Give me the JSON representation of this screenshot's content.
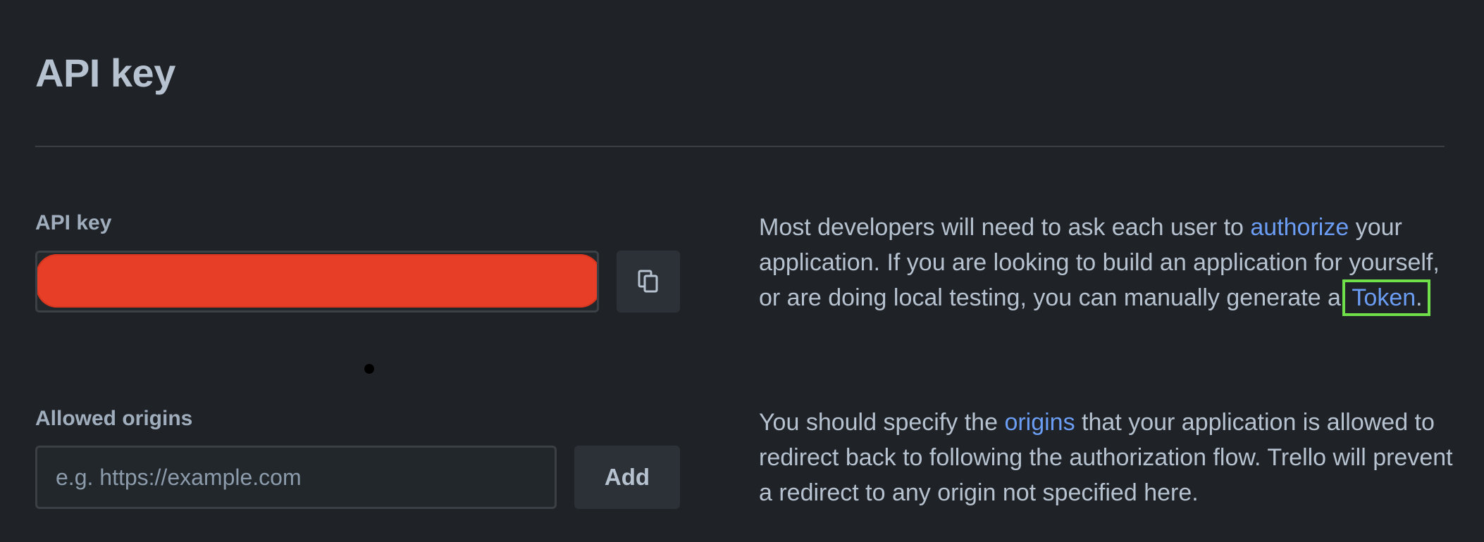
{
  "page": {
    "title": "API key"
  },
  "api_key": {
    "label": "API key",
    "value": "",
    "copy_icon": "copy-icon"
  },
  "help_authorize": {
    "text_before_authorize": "Most developers will need to ask each user to ",
    "authorize_link": "authorize",
    "text_after_authorize": " your application. If you are looking to build an application for yourself, or are doing local testing, you can manually generate a ",
    "token_link": "Token",
    "text_end": "."
  },
  "allowed_origins": {
    "label": "Allowed origins",
    "placeholder": "e.g. https://example.com",
    "value": "",
    "add_label": "Add"
  },
  "help_origins": {
    "text_before_origins": "You should specify the ",
    "origins_link": "origins",
    "text_after_origins": " that your application is allowed to redirect back to following the authorization flow. Trello will prevent a redirect to any origin not specified here."
  },
  "colors": {
    "background": "#1f2227",
    "text": "#b6c2cf",
    "link": "#6b9df5",
    "redaction": "#e63e27",
    "highlight": "#6fe04a"
  }
}
